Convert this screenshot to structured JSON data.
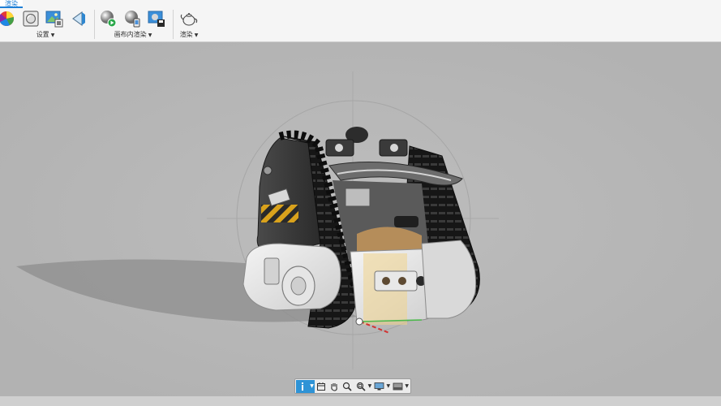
{
  "ribbon": {
    "active_tab": "渲染",
    "groups": [
      {
        "label": "设置",
        "has_dropdown": true
      },
      {
        "label": "画布内渲染",
        "has_dropdown": true
      },
      {
        "label": "渲染",
        "has_dropdown": true
      }
    ],
    "icons": {
      "group1": [
        "color-wheel-icon",
        "scene-settings-icon",
        "environment-image-icon",
        "decal-icon"
      ],
      "group2": [
        "render-start-icon",
        "render-options-icon",
        "render-save-icon"
      ],
      "group3": [
        "render-teapot-icon"
      ]
    }
  },
  "navbar": {
    "items": [
      "navigation-bar-active-icon",
      "view-cube-icon",
      "pan-hand-icon",
      "zoom-icon",
      "zoom-window-icon",
      "display-settings-icon",
      "environment-display-icon"
    ]
  },
  "viewport": {
    "model": "tracked-robot-model"
  }
}
